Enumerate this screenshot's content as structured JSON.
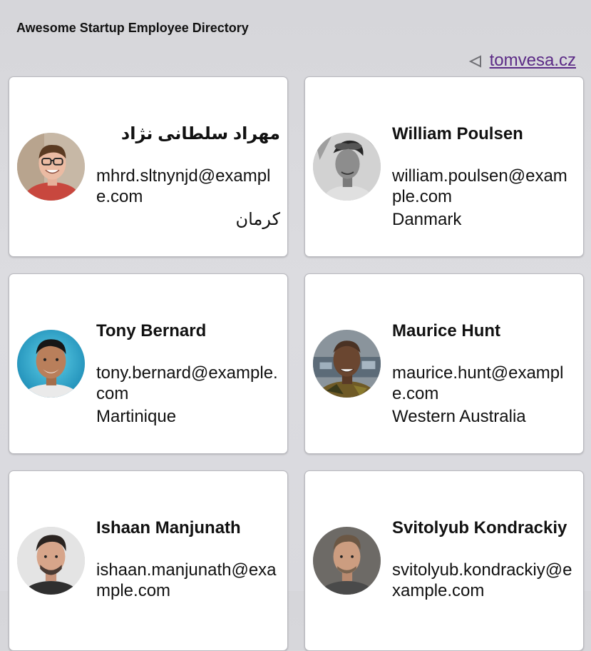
{
  "header": {
    "title": "Awesome Startup Employee Directory"
  },
  "nav": {
    "link_text": "tomvesa.cz",
    "icon": "back-triangle-icon"
  },
  "employees": [
    {
      "name": "مهراد سلطانی نژاد",
      "email": "mhrd.sltnynjd@example.com",
      "location": "کرمان",
      "avatar_colors": {
        "bg": "#c8b6a4",
        "skin": "#e9b7a0",
        "hair": "#5a3a22",
        "shirt": "#c8473e"
      }
    },
    {
      "name": "William Poulsen",
      "email": "william.poulsen@example.com",
      "location": "Danmark",
      "avatar_colors": {
        "bg": "#d6d6d6",
        "skin": "#8a8a8a",
        "hair": "#2a2a2a",
        "shirt": "#cfcfcf"
      }
    },
    {
      "name": "Tony Bernard",
      "email": "tony.bernard@example.com",
      "location": "Martinique",
      "avatar_colors": {
        "bg": "#2aa7c9",
        "skin": "#b37a55",
        "hair": "#1a1a1a",
        "shirt": "#e6e6e6"
      }
    },
    {
      "name": "Maurice Hunt",
      "email": "maurice.hunt@example.com",
      "location": "Western Australia",
      "avatar_colors": {
        "bg": "#7e8a93",
        "skin": "#6a4630",
        "hair": "#3a2a1e",
        "shirt": "#6e5a2a"
      }
    },
    {
      "name": "Ishaan Manjunath",
      "email": "ishaan.manjunath@example.com",
      "location": "",
      "avatar_colors": {
        "bg": "#e5e5e5",
        "skin": "#d6a386",
        "hair": "#2a2320",
        "shirt": "#333333"
      }
    },
    {
      "name": "Svitolyub Kondrackiy",
      "email": "svitolyub.kondrackiy@example.com",
      "location": "",
      "avatar_colors": {
        "bg": "#6d6a66",
        "skin": "#c99a7d",
        "hair": "#6b5744",
        "shirt": "#4a4a4a"
      }
    }
  ]
}
